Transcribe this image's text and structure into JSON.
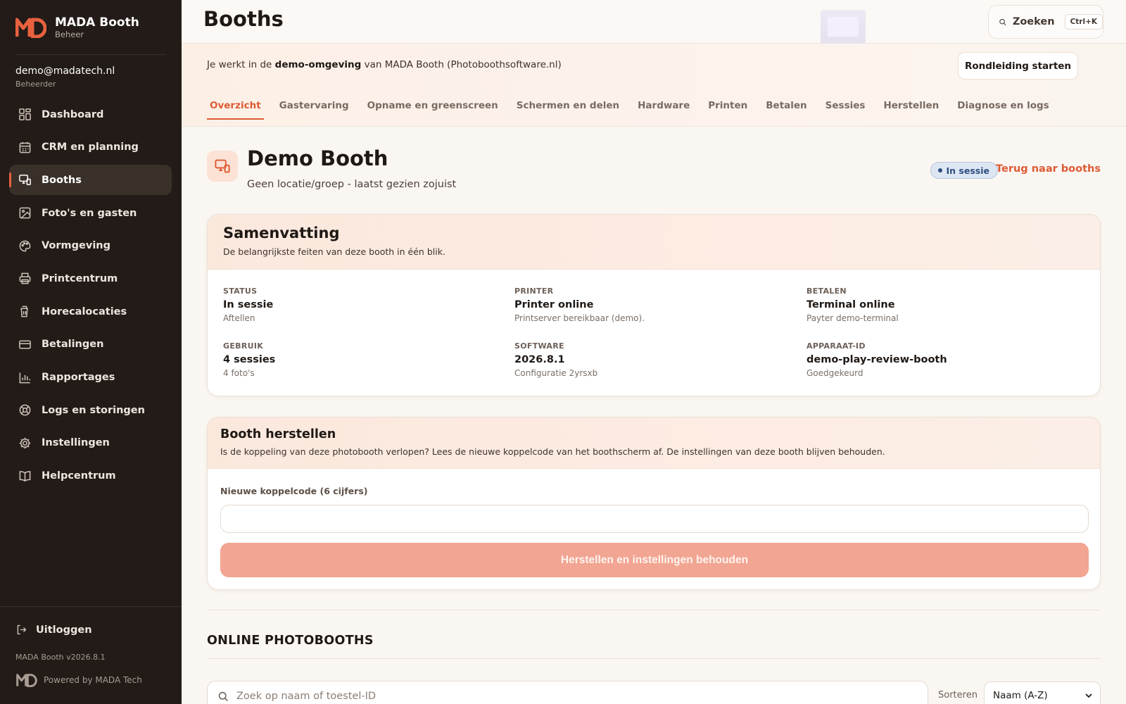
{
  "brand": {
    "name": "MADA Booth",
    "sub": "Beheer"
  },
  "user": {
    "email": "demo@madatech.nl",
    "role": "Beheerder"
  },
  "nav": [
    {
      "label": "Dashboard",
      "icon": "dashboard-icon"
    },
    {
      "label": "CRM en planning",
      "icon": "calendar-icon"
    },
    {
      "label": "Booths",
      "icon": "booth-icon",
      "active": true
    },
    {
      "label": "Foto's en gasten",
      "icon": "image-icon"
    },
    {
      "label": "Vormgeving",
      "icon": "palette-icon"
    },
    {
      "label": "Printcentrum",
      "icon": "printer-icon"
    },
    {
      "label": "Horecalocaties",
      "icon": "cup-icon"
    },
    {
      "label": "Betalingen",
      "icon": "card-icon"
    },
    {
      "label": "Rapportages",
      "icon": "bar-chart-icon"
    },
    {
      "label": "Logs en storingen",
      "icon": "lifebuoy-icon"
    },
    {
      "label": "Instellingen",
      "icon": "gear-icon"
    },
    {
      "label": "Helpcentrum",
      "icon": "book-icon"
    }
  ],
  "footer": {
    "logout": "Uitloggen",
    "version": "MADA Booth v2026.8.1",
    "powered": "Powered by MADA Tech"
  },
  "header": {
    "title": "Booths",
    "search_label": "Zoeken",
    "shortcut": "Ctrl+K"
  },
  "demo": {
    "prefix": "Je werkt in de ",
    "bold": "demo-omgeving",
    "suffix": " van MADA Booth (Photoboothsoftware.nl)",
    "tour_button": "Rondleiding starten"
  },
  "tabs": [
    {
      "label": "Overzicht",
      "active": true
    },
    {
      "label": "Gastervaring"
    },
    {
      "label": "Opname en greenscreen"
    },
    {
      "label": "Schermen en delen"
    },
    {
      "label": "Hardware"
    },
    {
      "label": "Printen"
    },
    {
      "label": "Betalen"
    },
    {
      "label": "Sessies"
    },
    {
      "label": "Herstellen"
    },
    {
      "label": "Diagnose en logs"
    }
  ],
  "booth": {
    "title": "Demo Booth",
    "subtitle": "Geen locatie/groep - laatst gezien zojuist",
    "badge": "In sessie",
    "back_link": "Terug naar booths"
  },
  "summary": {
    "title": "Samenvatting",
    "description": "De belangrijkste feiten van deze booth in één blik.",
    "items": [
      {
        "key": "STATUS",
        "value": "In sessie",
        "sub": "Aftellen"
      },
      {
        "key": "PRINTER",
        "value": "Printer online",
        "sub": "Printserver bereikbaar (demo)."
      },
      {
        "key": "BETALEN",
        "value": "Terminal online",
        "sub": "Payter demo-terminal"
      },
      {
        "key": "GEBRUIK",
        "value": "4 sessies",
        "sub": "4 foto's"
      },
      {
        "key": "SOFTWARE",
        "value": "2026.8.1",
        "sub": "Configuratie 2yrsxb"
      },
      {
        "key": "APPARAAT-ID",
        "value": "demo-play-review-booth",
        "sub": "Goedgekeurd"
      }
    ]
  },
  "restore": {
    "title": "Booth herstellen",
    "description": "Is de koppeling van deze photobooth verlopen? Lees de nieuwe koppelcode van het boothscherm af. De instellingen van deze booth blijven behouden.",
    "field_label": "Nieuwe koppelcode (6 cijfers)",
    "field_value": "",
    "button": "Herstellen en instellingen behouden"
  },
  "online": {
    "title": "ONLINE PHOTOBOOTHS",
    "search_placeholder": "Zoek op naam of toestel-ID",
    "sort_label": "Sorteren",
    "sort_value": "Naam (A-Z)"
  },
  "colors": {
    "accent": "#dd5a34",
    "sidebar": "#221b17",
    "badge_bg": "#dde6f3",
    "button_disabled": "#f1a592"
  }
}
